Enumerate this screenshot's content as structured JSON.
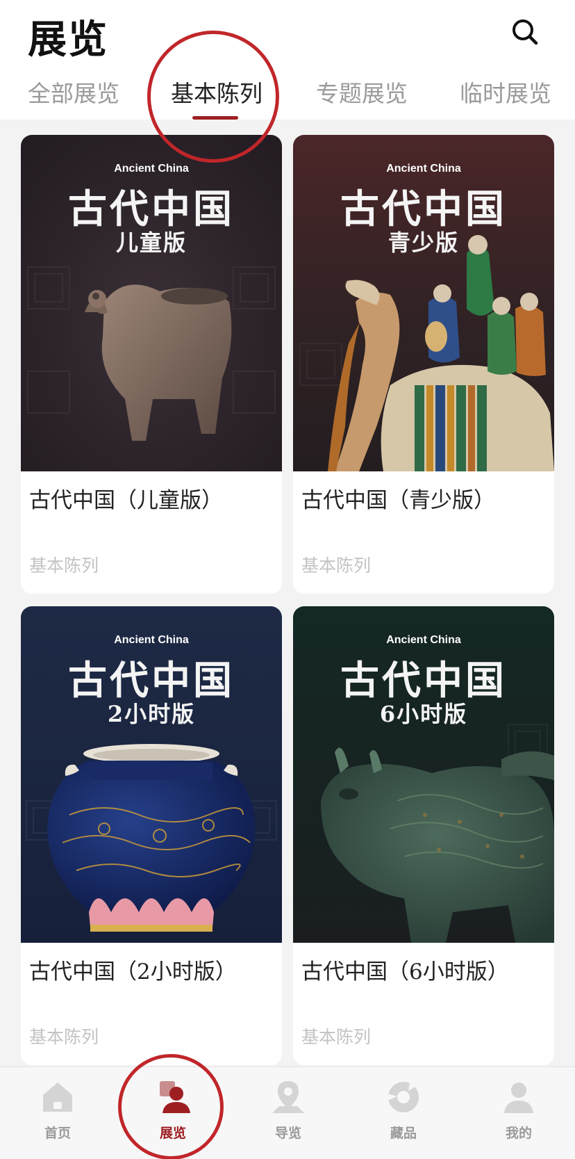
{
  "header": {
    "title": "展览",
    "search_icon": "search-icon"
  },
  "tabs": [
    {
      "label": "全部展览",
      "active": false
    },
    {
      "label": "基本陈列",
      "active": true
    },
    {
      "label": "专题展览",
      "active": false
    },
    {
      "label": "临时展览",
      "active": false
    }
  ],
  "cards": [
    {
      "cover_en": "Ancient China",
      "cover_zh": "古代中国",
      "cover_sub": "儿童版",
      "title": "古代中国（儿童版）",
      "category": "基本陈列",
      "artifact": "bronze-bird-vessel"
    },
    {
      "cover_en": "Ancient China",
      "cover_zh": "古代中国",
      "cover_sub": "青少版",
      "title": "古代中国（青少版）",
      "category": "基本陈列",
      "artifact": "sancai-camel-with-musicians"
    },
    {
      "cover_en": "Ancient China",
      "cover_zh": "古代中国",
      "cover_sub": "2小时版",
      "title": "古代中国（2小时版）",
      "category": "基本陈列",
      "artifact": "blue-gilt-porcelain-jar"
    },
    {
      "cover_en": "Ancient China",
      "cover_zh": "古代中国",
      "cover_sub": "6小时版",
      "title": "古代中国（6小时版）",
      "category": "基本陈列",
      "artifact": "bronze-rhinoceros-zun"
    }
  ],
  "bottom_nav": [
    {
      "label": "首页",
      "icon": "home-icon",
      "active": false
    },
    {
      "label": "展览",
      "icon": "exhibition-icon",
      "active": true
    },
    {
      "label": "导览",
      "icon": "location-pin-icon",
      "active": false
    },
    {
      "label": "藏品",
      "icon": "collection-icon",
      "active": false
    },
    {
      "label": "我的",
      "icon": "user-icon",
      "active": false
    }
  ],
  "colors": {
    "accent": "#9e1f22",
    "inactive": "#9a9a9a",
    "annotation": "#c0262a"
  }
}
